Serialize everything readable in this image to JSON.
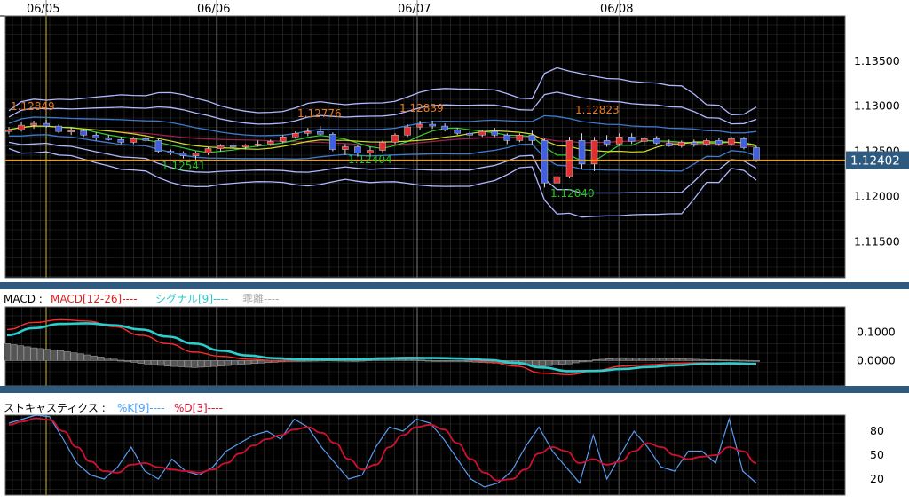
{
  "dates": [
    "06/05",
    "06/06",
    "06/07",
    "06/08"
  ],
  "price_panel": {
    "current_price_label": "1.12402",
    "y_ticks": [
      "1.13500",
      "1.13000",
      "1.12500",
      "1.12000",
      "1.11500"
    ],
    "annotations": [
      "1.12849",
      "1.12541",
      "1.12776",
      "1.12404",
      "1.12839",
      "1.12040",
      "1.12823"
    ]
  },
  "macd_panel": {
    "title": "MACD :",
    "legend": {
      "macd": "MACD[12-26]----",
      "signal": "シグナル[9]----",
      "divergence": "乖離----"
    },
    "y_ticks": [
      "0.1000",
      "0.0000"
    ]
  },
  "stoch_panel": {
    "title": "ストキャスティクス :",
    "legend": {
      "k": "%K[9]----",
      "d": "%D[3]----"
    },
    "y_ticks": [
      "80",
      "50",
      "20"
    ]
  },
  "colors": {
    "background": "#000000",
    "grid": "#333333",
    "bull_candle": "#e03030",
    "bear_candle": "#4060e0",
    "bollinger": "#b0b8ff",
    "sma_fast": "#33cc33",
    "sma_slow": "#d0e020",
    "current_line": "#ff9900",
    "macd": "#ff2a2a",
    "signal": "#2ecccc",
    "histogram": "#888888",
    "stoch_k": "#5a9cf0",
    "stoch_d": "#d01030"
  },
  "chart_data": [
    {
      "type": "candlestick",
      "series": [
        {
          "name": "Price",
          "values": [
            [
              1.1272,
              1.1277,
              1.1269,
              1.1274
            ],
            [
              1.1274,
              1.1282,
              1.1272,
              1.1279
            ],
            [
              1.1279,
              1.1284,
              1.1275,
              1.1281
            ],
            [
              1.1281,
              1.1285,
              1.1276,
              1.1278
            ],
            [
              1.1278,
              1.128,
              1.127,
              1.1272
            ],
            [
              1.1272,
              1.1276,
              1.1268,
              1.1273
            ],
            [
              1.1273,
              1.1275,
              1.1266,
              1.1268
            ],
            [
              1.1268,
              1.1271,
              1.1262,
              1.1265
            ],
            [
              1.1265,
              1.1268,
              1.1262,
              1.1263
            ],
            [
              1.1263,
              1.1266,
              1.1258,
              1.126
            ],
            [
              1.126,
              1.1266,
              1.1258,
              1.1264
            ],
            [
              1.1264,
              1.1268,
              1.126,
              1.1262
            ],
            [
              1.1262,
              1.1264,
              1.1248,
              1.125
            ],
            [
              1.125,
              1.1252,
              1.1246,
              1.1248
            ],
            [
              1.1248,
              1.125,
              1.1242,
              1.1245
            ],
            [
              1.1245,
              1.125,
              1.1241,
              1.1248
            ],
            [
              1.1248,
              1.1255,
              1.1246,
              1.1253
            ],
            [
              1.1253,
              1.1258,
              1.125,
              1.1256
            ],
            [
              1.1256,
              1.126,
              1.1253,
              1.1255
            ],
            [
              1.1255,
              1.1258,
              1.1252,
              1.1257
            ],
            [
              1.1257,
              1.1262,
              1.1255,
              1.1258
            ],
            [
              1.1258,
              1.1263,
              1.1256,
              1.1261
            ],
            [
              1.1261,
              1.1268,
              1.1259,
              1.1266
            ],
            [
              1.1266,
              1.1272,
              1.1264,
              1.127
            ],
            [
              1.127,
              1.1276,
              1.1267,
              1.1272
            ],
            [
              1.1272,
              1.1278,
              1.1268,
              1.1269
            ],
            [
              1.1269,
              1.1271,
              1.125,
              1.1252
            ],
            [
              1.1252,
              1.1258,
              1.1246,
              1.1255
            ],
            [
              1.1255,
              1.1257,
              1.1244,
              1.1248
            ],
            [
              1.1248,
              1.1255,
              1.1245,
              1.1251
            ],
            [
              1.1251,
              1.1262,
              1.1249,
              1.126
            ],
            [
              1.126,
              1.127,
              1.1258,
              1.1268
            ],
            [
              1.1268,
              1.128,
              1.1266,
              1.1277
            ],
            [
              1.1277,
              1.1284,
              1.1274,
              1.128
            ],
            [
              1.128,
              1.1284,
              1.1275,
              1.1278
            ],
            [
              1.1278,
              1.1281,
              1.1272,
              1.1274
            ],
            [
              1.1274,
              1.1276,
              1.1268,
              1.127
            ],
            [
              1.127,
              1.1272,
              1.1265,
              1.1268
            ],
            [
              1.1268,
              1.1274,
              1.1266,
              1.1272
            ],
            [
              1.1272,
              1.1276,
              1.1266,
              1.1268
            ],
            [
              1.1268,
              1.127,
              1.1258,
              1.1262
            ],
            [
              1.1262,
              1.127,
              1.126,
              1.1268
            ],
            [
              1.1268,
              1.1273,
              1.1258,
              1.1262
            ],
            [
              1.1262,
              1.1264,
              1.121,
              1.1215
            ],
            [
              1.1215,
              1.1226,
              1.1204,
              1.1222
            ],
            [
              1.1222,
              1.1266,
              1.122,
              1.1262
            ],
            [
              1.1262,
              1.127,
              1.123,
              1.1236
            ],
            [
              1.1236,
              1.1266,
              1.1228,
              1.1262
            ],
            [
              1.1262,
              1.1268,
              1.1255,
              1.1258
            ],
            [
              1.1258,
              1.127,
              1.1256,
              1.1266
            ],
            [
              1.1266,
              1.127,
              1.1258,
              1.1261
            ],
            [
              1.1261,
              1.1266,
              1.1256,
              1.1264
            ],
            [
              1.1264,
              1.1267,
              1.1257,
              1.1259
            ],
            [
              1.1259,
              1.1263,
              1.1255,
              1.1256
            ],
            [
              1.1256,
              1.1262,
              1.1254,
              1.126
            ],
            [
              1.126,
              1.1263,
              1.1255,
              1.1258
            ],
            [
              1.1258,
              1.1264,
              1.1256,
              1.1262
            ],
            [
              1.1262,
              1.1265,
              1.1256,
              1.1258
            ],
            [
              1.1258,
              1.1266,
              1.1256,
              1.1264
            ],
            [
              1.1264,
              1.1266,
              1.1252,
              1.1254
            ],
            [
              1.1254,
              1.1256,
              1.1238,
              1.124
            ]
          ]
        }
      ],
      "ylim": [
        1.111,
        1.14
      ]
    },
    {
      "type": "line",
      "title": "MACD :",
      "series": [
        {
          "name": "MACD[12-26]",
          "values": [
            0.11,
            0.135,
            0.145,
            0.14,
            0.12,
            0.09,
            0.06,
            0.03,
            0.015,
            0.005,
            0,
            0.003,
            0.006,
            0.005,
            0.01,
            0.012,
            0.01,
            0.005,
            -0.005,
            -0.02,
            -0.045,
            -0.05,
            -0.035,
            -0.02,
            -0.015,
            -0.01,
            -0.008,
            -0.01,
            -0.015
          ]
        },
        {
          "name": "シグナル[9]",
          "values": [
            0.09,
            0.115,
            0.13,
            0.132,
            0.125,
            0.11,
            0.085,
            0.06,
            0.035,
            0.018,
            0.008,
            0.004,
            0.004,
            0.004,
            0.007,
            0.009,
            0.009,
            0.007,
            0.002,
            -0.008,
            -0.025,
            -0.038,
            -0.037,
            -0.03,
            -0.023,
            -0.017,
            -0.012,
            -0.01,
            -0.012
          ]
        },
        {
          "name": "乖離",
          "values": [
            0.06,
            0.045,
            0.035,
            0.02,
            0.005,
            -0.01,
            -0.02,
            -0.025,
            -0.02,
            -0.012,
            -0.006,
            0,
            0.002,
            0,
            0.004,
            0.004,
            0,
            -0.003,
            -0.008,
            -0.012,
            -0.02,
            -0.012,
            0.003,
            0.01,
            0.008,
            0.007,
            0.004,
            0.002,
            0
          ]
        }
      ],
      "ylim": [
        -0.09,
        0.19
      ]
    },
    {
      "type": "line",
      "title": "ストキャスティクス :",
      "series": [
        {
          "name": "%K[9]",
          "values": [
            90,
            95,
            100,
            98,
            70,
            40,
            25,
            20,
            35,
            60,
            30,
            20,
            45,
            30,
            25,
            35,
            55,
            65,
            75,
            80,
            70,
            95,
            85,
            60,
            40,
            20,
            25,
            60,
            85,
            80,
            95,
            90,
            70,
            45,
            20,
            10,
            15,
            30,
            60,
            85,
            55,
            35,
            15,
            75,
            20,
            50,
            80,
            60,
            35,
            30,
            55,
            55,
            40,
            95,
            30,
            15
          ]
        },
        {
          "name": "%D[3]",
          "values": [
            88,
            92,
            96,
            94,
            80,
            60,
            42,
            30,
            28,
            38,
            40,
            35,
            32,
            30,
            28,
            32,
            40,
            52,
            62,
            70,
            75,
            82,
            85,
            78,
            65,
            45,
            32,
            38,
            60,
            75,
            85,
            88,
            82,
            65,
            45,
            28,
            18,
            20,
            32,
            52,
            60,
            55,
            40,
            45,
            38,
            42,
            55,
            65,
            60,
            50,
            45,
            48,
            50,
            60,
            55,
            40
          ]
        }
      ],
      "ylim": [
        0,
        100
      ]
    }
  ]
}
